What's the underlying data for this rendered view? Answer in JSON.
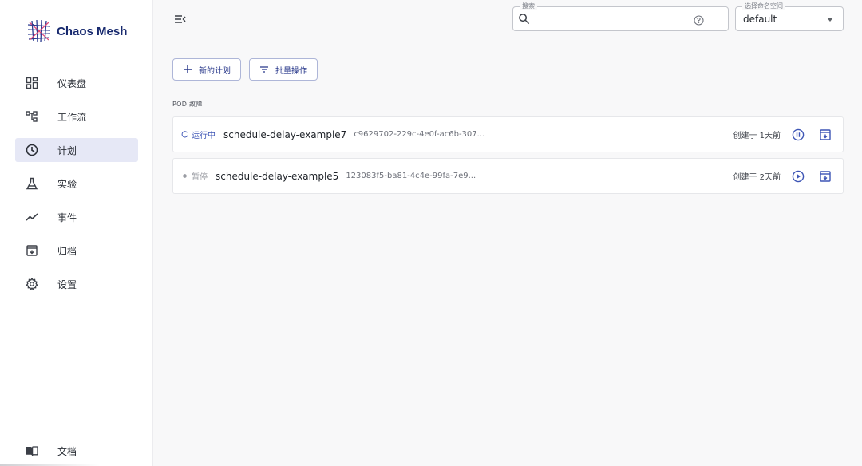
{
  "app": {
    "title": "Chaos Mesh"
  },
  "sidebar": {
    "items": [
      {
        "label": "仪表盘",
        "icon": "dashboard-icon"
      },
      {
        "label": "工作流",
        "icon": "workflow-icon"
      },
      {
        "label": "计划",
        "icon": "clock-icon",
        "active": true
      },
      {
        "label": "实验",
        "icon": "flask-icon"
      },
      {
        "label": "事件",
        "icon": "events-chart-icon"
      },
      {
        "label": "归档",
        "icon": "archive-icon"
      },
      {
        "label": "设置",
        "icon": "gear-icon"
      }
    ],
    "bottom": {
      "label": "文档",
      "icon": "book-icon"
    }
  },
  "topbar": {
    "search": {
      "label": "搜索",
      "value": "",
      "placeholder": ""
    },
    "namespace": {
      "label": "选择命名空间",
      "value": "default"
    }
  },
  "actions": {
    "new_schedule": "新的计划",
    "batch": "批量操作"
  },
  "section": {
    "title": "POD 故障"
  },
  "schedules": [
    {
      "status": "运行中",
      "state": "running",
      "name": "schedule-delay-example7",
      "uid": "c9629702-229c-4e0f-ac6b-307...",
      "created": "创建于 1天前"
    },
    {
      "status": "暂停",
      "state": "paused",
      "name": "schedule-delay-example5",
      "uid": "123083f5-ba81-4c4e-99fa-7e9...",
      "created": "创建于 2天前"
    }
  ],
  "colors": {
    "accent": "#3d55b5",
    "brand": "#17296e",
    "active_nav_bg": "#e6e8f6"
  }
}
